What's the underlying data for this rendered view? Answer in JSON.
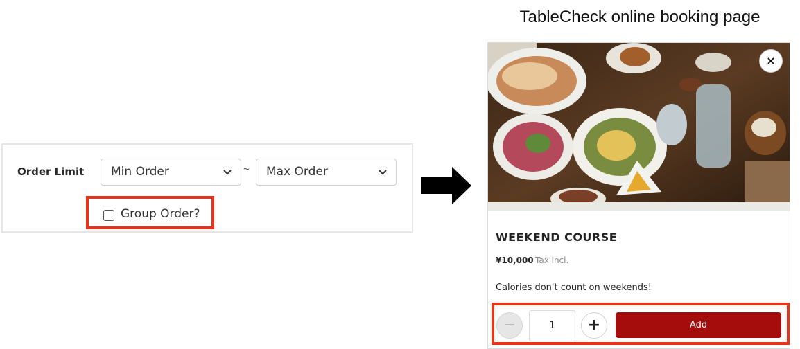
{
  "admin": {
    "order_limit_label": "Order Limit",
    "min_select": "Min Order",
    "separator": "~",
    "max_select": "Max Order",
    "group_order_label": "Group Order?",
    "group_order_checked": false
  },
  "booking": {
    "page_heading": "TableCheck online booking page",
    "close_glyph": "×",
    "course_title": "WEEKEND COURSE",
    "price": "¥10,000",
    "tax_note": "Tax incl.",
    "description": "Calories don't count on weekends!",
    "quantity": "1",
    "minus_glyph": "−",
    "plus_glyph": "+",
    "add_label": "Add"
  },
  "colors": {
    "highlight": "#e8321a",
    "add_button": "#a40d0b"
  },
  "icons": {
    "arrow": "right-arrow-icon",
    "chevron": "chevron-down-icon",
    "close": "close-icon"
  }
}
